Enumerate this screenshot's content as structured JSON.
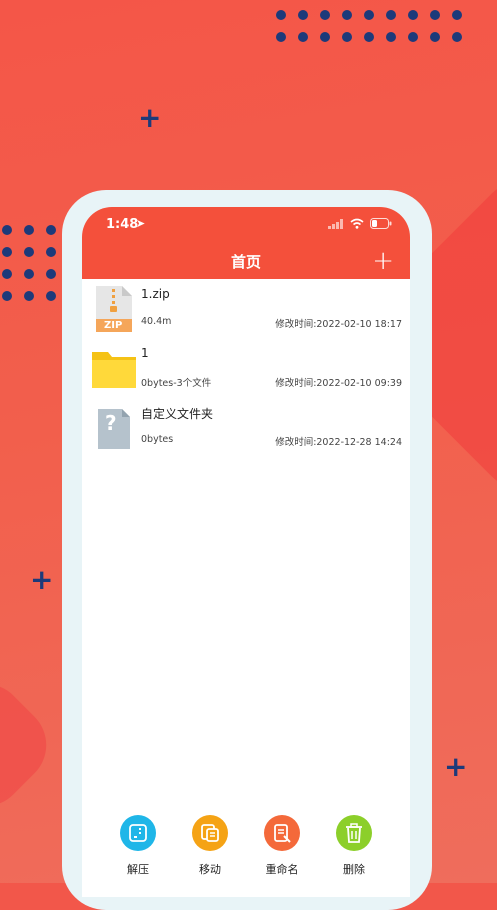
{
  "status": {
    "time": "1:48"
  },
  "nav": {
    "title": "首页",
    "add_label": "+"
  },
  "files": [
    {
      "name": "1.zip",
      "size": "40.4m",
      "mtime": "修改时间:2022-02-10 18:17",
      "icon": "zip-file-icon",
      "badge": "ZIP"
    },
    {
      "name": "1",
      "size": "0bytes-3个文件",
      "mtime": "修改时间:2022-02-10 09:39",
      "icon": "folder-icon"
    },
    {
      "name": "自定义文件夹",
      "size": "0bytes",
      "mtime": "修改时间:2022-12-28 14:24",
      "icon": "unknown-file-icon",
      "badge": "?"
    }
  ],
  "toolbar": [
    {
      "label": "解压",
      "icon": "unzip-icon",
      "color": "#1fb6e8"
    },
    {
      "label": "移动",
      "icon": "move-icon",
      "color": "#f5a315"
    },
    {
      "label": "重命名",
      "icon": "rename-icon",
      "color": "#f4693a"
    },
    {
      "label": "删除",
      "icon": "delete-icon",
      "color": "#8ccf2a"
    }
  ],
  "colors": {
    "accent": "#f4503b",
    "background": "#f2574a",
    "deco": "#1d3a7a"
  }
}
